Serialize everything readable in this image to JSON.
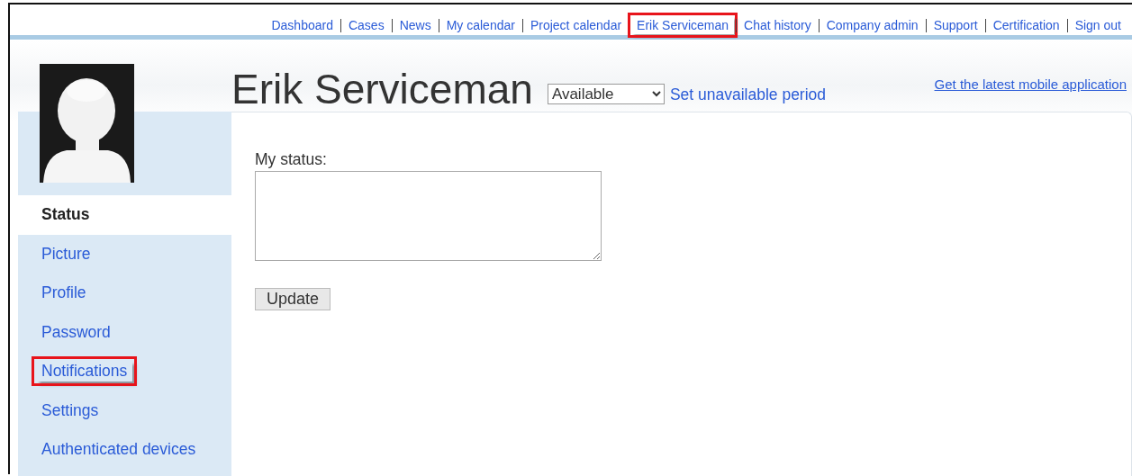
{
  "top_nav": [
    {
      "label": "Dashboard",
      "highlighted": false
    },
    {
      "label": "Cases",
      "highlighted": false
    },
    {
      "label": "News",
      "highlighted": false
    },
    {
      "label": "My calendar",
      "highlighted": false
    },
    {
      "label": "Project calendar",
      "highlighted": false
    },
    {
      "label": "Erik Serviceman",
      "highlighted": true
    },
    {
      "label": "Chat history",
      "highlighted": false
    },
    {
      "label": "Company admin",
      "highlighted": false
    },
    {
      "label": "Support",
      "highlighted": false
    },
    {
      "label": "Certification",
      "highlighted": false
    },
    {
      "label": "Sign out",
      "highlighted": false
    }
  ],
  "header": {
    "name": "Erik Serviceman",
    "availability": "Available",
    "unavailable_link": "Set unavailable period",
    "mobile_link": "Get the latest mobile application"
  },
  "sidebar": {
    "items": [
      {
        "label": "Status",
        "selected": true,
        "highlighted": false
      },
      {
        "label": "Picture",
        "selected": false,
        "highlighted": false
      },
      {
        "label": "Profile",
        "selected": false,
        "highlighted": false
      },
      {
        "label": "Password",
        "selected": false,
        "highlighted": false
      },
      {
        "label": "Notifications",
        "selected": false,
        "highlighted": true
      },
      {
        "label": "Settings",
        "selected": false,
        "highlighted": false
      },
      {
        "label": "Authenticated devices",
        "selected": false,
        "highlighted": false
      }
    ]
  },
  "status_form": {
    "label": "My status:",
    "button": "Update"
  }
}
